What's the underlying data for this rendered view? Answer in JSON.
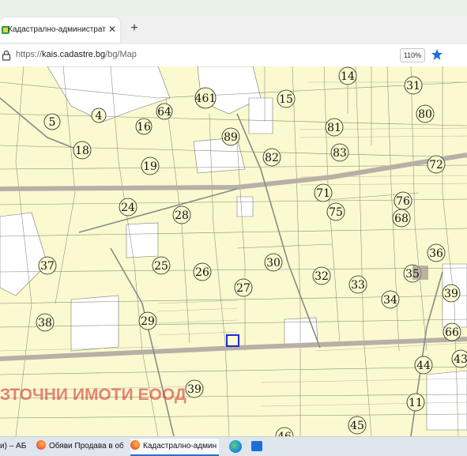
{
  "browser": {
    "tab_title": "Кадастрално-административн",
    "new_tab_symbol": "+",
    "close_symbol": "✕",
    "url_prefix": "https://",
    "url_host": "kais.cadastre.bg",
    "url_path": "/bg/Map",
    "zoom": "110%"
  },
  "map": {
    "watermark": "ЗТОЧНИ ИМОТИ ЕООД",
    "parcel_labels": [
      "5",
      "4",
      "16",
      "64",
      "461",
      "15",
      "14",
      "31",
      "80",
      "81",
      "89",
      "18",
      "82",
      "83",
      "19",
      "72",
      "71",
      "24",
      "28",
      "75",
      "76",
      "68",
      "37",
      "25",
      "26",
      "30",
      "32",
      "33",
      "36",
      "35",
      "27",
      "34",
      "39",
      "38",
      "29",
      "66",
      "44",
      "43",
      "39",
      "11",
      "45",
      "46"
    ],
    "highlight_color": "#1a2ad8"
  },
  "taskbar": {
    "items": [
      {
        "label": "и) – АБ"
      },
      {
        "label": "Обяви Продава в об"
      },
      {
        "label": "Кадастрално-админ"
      }
    ]
  }
}
